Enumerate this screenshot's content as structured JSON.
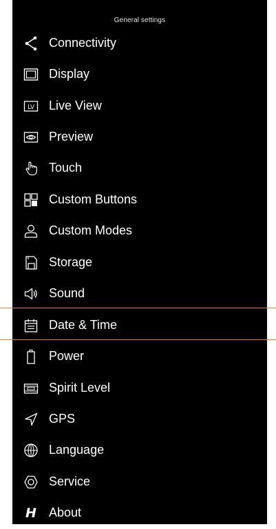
{
  "header": {
    "title": "General settings"
  },
  "selected_index": 10,
  "accent_color": "#e27b3b",
  "menu": {
    "items": [
      {
        "label": "Connectivity",
        "icon": "share-icon"
      },
      {
        "label": "Display",
        "icon": "display-icon"
      },
      {
        "label": "Live View",
        "icon": "live-view-icon"
      },
      {
        "label": "Preview",
        "icon": "preview-eye-icon"
      },
      {
        "label": "Touch",
        "icon": "touch-hand-icon"
      },
      {
        "label": "Custom Buttons",
        "icon": "custom-buttons-grid-icon"
      },
      {
        "label": "Custom Modes",
        "icon": "user-icon"
      },
      {
        "label": "Storage",
        "icon": "sd-card-icon"
      },
      {
        "label": "Sound",
        "icon": "speaker-icon"
      },
      {
        "label": "Date & Time",
        "icon": "calendar-icon"
      },
      {
        "label": "Power",
        "icon": "battery-icon"
      },
      {
        "label": "Spirit Level",
        "icon": "spirit-level-icon"
      },
      {
        "label": "GPS",
        "icon": "location-arrow-icon"
      },
      {
        "label": "Language",
        "icon": "globe-icon"
      },
      {
        "label": "Service",
        "icon": "hexagon-service-icon"
      },
      {
        "label": "About",
        "icon": "hasselblad-logo-icon",
        "icon_text": "H"
      }
    ]
  }
}
